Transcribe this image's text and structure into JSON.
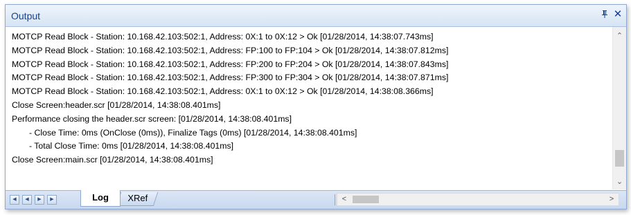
{
  "panel": {
    "title": "Output",
    "pin_icon": "pin-icon",
    "close_icon": "close-icon"
  },
  "log": {
    "lines": [
      {
        "text": "MOTCP Read Block - Station: 10.168.42.103:502:1, Address: 0X:1 to 0X:12 > Ok [01/28/2014, 14:38:07.743ms]",
        "indent": false
      },
      {
        "text": "MOTCP Read Block - Station: 10.168.42.103:502:1, Address: FP:100 to FP:104 > Ok [01/28/2014, 14:38:07.812ms]",
        "indent": false
      },
      {
        "text": "MOTCP Read Block - Station: 10.168.42.103:502:1, Address: FP:200 to FP:204 > Ok [01/28/2014, 14:38:07.843ms]",
        "indent": false
      },
      {
        "text": "MOTCP Read Block - Station: 10.168.42.103:502:1, Address: FP:300 to FP:304 > Ok [01/28/2014, 14:38:07.871ms]",
        "indent": false
      },
      {
        "text": "MOTCP Read Block - Station: 10.168.42.103:502:1, Address: 0X:1 to 0X:12 > Ok [01/28/2014, 14:38:08.366ms]",
        "indent": false
      },
      {
        "text": "Close Screen:header.scr [01/28/2014, 14:38:08.401ms]",
        "indent": false
      },
      {
        "text": "Performance closing the header.scr screen: [01/28/2014, 14:38:08.401ms]",
        "indent": false
      },
      {
        "text": "- Close Time: 0ms (OnClose (0ms)), Finalize Tags (0ms) [01/28/2014, 14:38:08.401ms]",
        "indent": true
      },
      {
        "text": "- Total Close Time: 0ms [01/28/2014, 14:38:08.401ms]",
        "indent": true
      },
      {
        "text": "Close Screen:main.scr [01/28/2014, 14:38:08.401ms]",
        "indent": false
      }
    ]
  },
  "tabs": [
    {
      "label": "Log",
      "active": true
    },
    {
      "label": "XRef",
      "active": false
    }
  ],
  "nav_buttons": [
    "first-icon",
    "prev-icon",
    "next-icon",
    "last-icon"
  ],
  "colors": {
    "title_text": "#15428b",
    "titlebar_top": "#eef4fc",
    "titlebar_bottom": "#d7e4f4",
    "border": "#8fa9cf",
    "bottombar": "#c8d8ef"
  }
}
